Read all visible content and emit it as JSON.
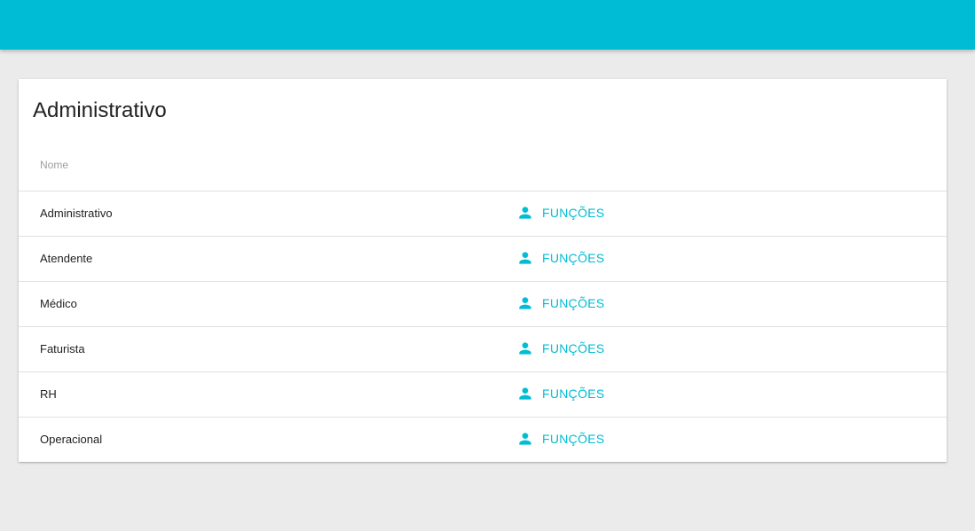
{
  "colors": {
    "primary": "#00bcd4",
    "background": "#ebebeb"
  },
  "card": {
    "title": "Administrativo",
    "table": {
      "header_name": "Nome",
      "rows": [
        {
          "name": "Administrativo",
          "action_label": "FUNÇÕES",
          "action_icon": "person-icon"
        },
        {
          "name": "Atendente",
          "action_label": "FUNÇÕES",
          "action_icon": "person-icon"
        },
        {
          "name": "Médico",
          "action_label": "FUNÇÕES",
          "action_icon": "person-icon"
        },
        {
          "name": "Faturista",
          "action_label": "FUNÇÕES",
          "action_icon": "person-icon"
        },
        {
          "name": "RH",
          "action_label": "FUNÇÕES",
          "action_icon": "person-icon"
        },
        {
          "name": "Operacional",
          "action_label": "FUNÇÕES",
          "action_icon": "person-icon"
        }
      ]
    }
  }
}
